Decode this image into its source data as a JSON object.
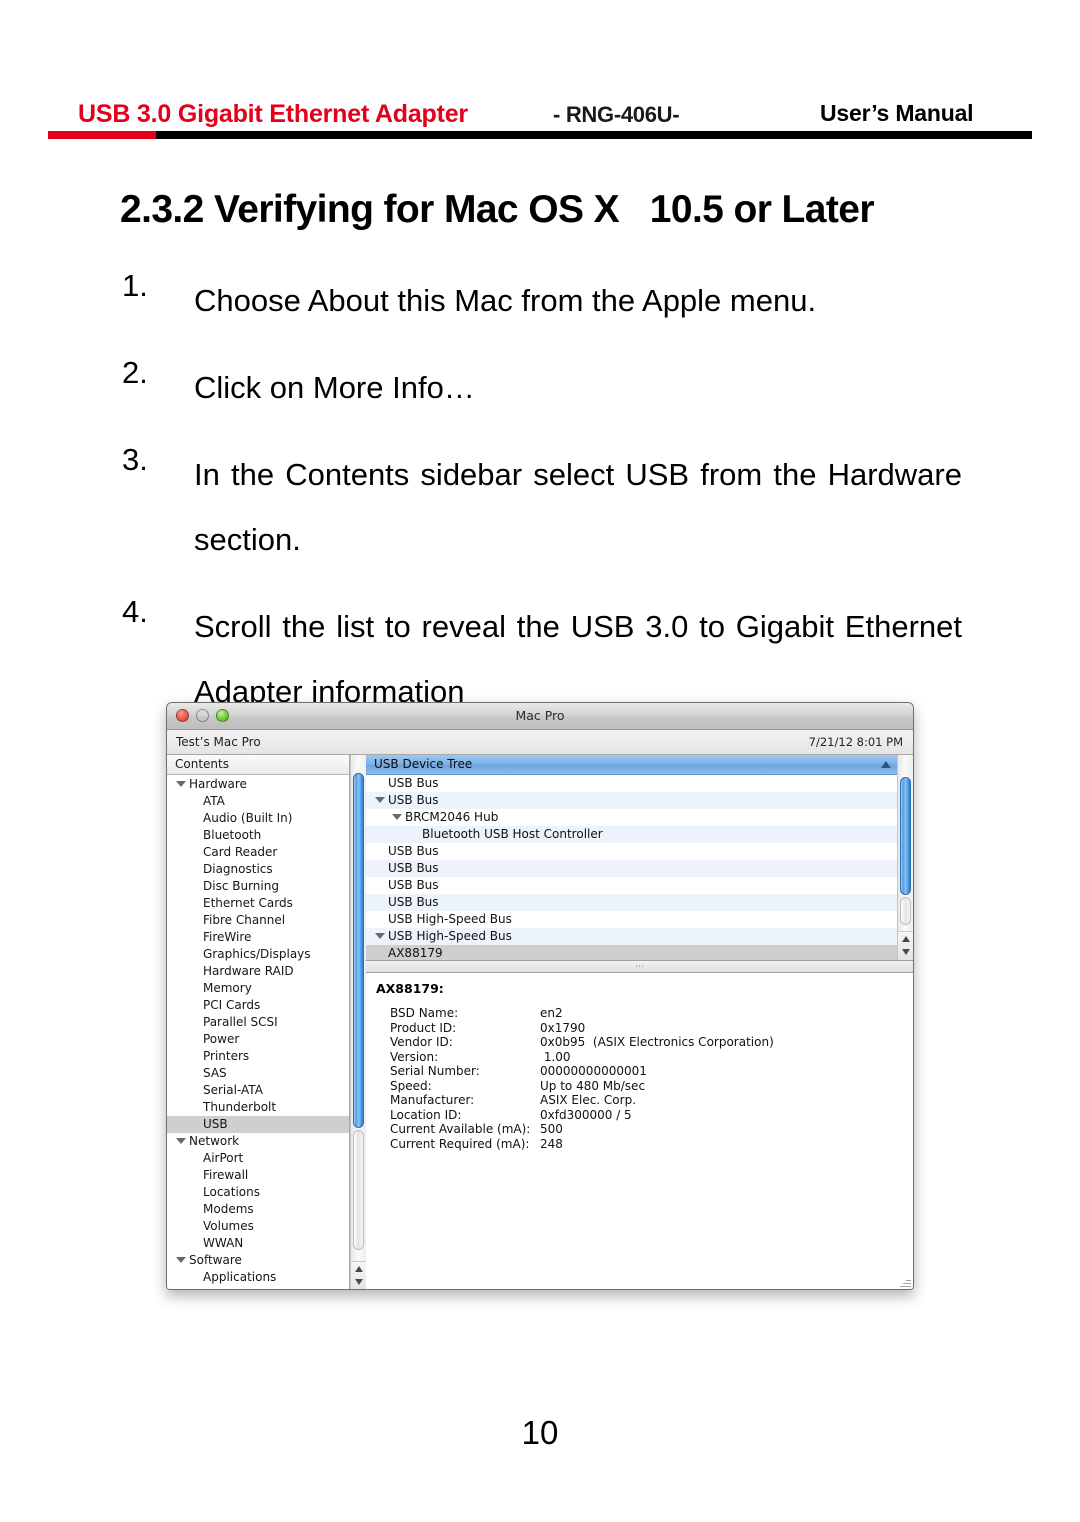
{
  "header": {
    "product_title": "USB 3.0 Gigabit Ethernet Adapter",
    "model": "- RNG-406U-",
    "doc_type": "User’s Manual",
    "accent_color": "#e2001a",
    "rule_color": "#000000"
  },
  "section": {
    "title": "2.3.2 Verifying for Mac OS X   10.5 or Later"
  },
  "steps": [
    {
      "num": "1.",
      "text": "Choose About this Mac from the Apple menu."
    },
    {
      "num": "2.",
      "text": "Click on More Info…"
    },
    {
      "num": "3.",
      "text": "In the Contents sidebar select USB from the Hardware section."
    },
    {
      "num": "4.",
      "text": "Scroll the list to reveal the USB 3.0 to Gigabit Ethernet Adapter information"
    }
  ],
  "screenshot": {
    "window_title": "Mac Pro",
    "machine_name": "Test’s Mac Pro",
    "timestamp": "7/21/12 8:01 PM",
    "traffic_lights": [
      "close-button",
      "minimize-button",
      "zoom-button"
    ],
    "sidebar": {
      "header": "Contents",
      "items": [
        {
          "label": "Hardware",
          "level": 0,
          "disclosure": true,
          "selected": false
        },
        {
          "label": "ATA",
          "level": 1,
          "disclosure": false,
          "selected": false
        },
        {
          "label": "Audio (Built In)",
          "level": 1,
          "disclosure": false,
          "selected": false
        },
        {
          "label": "Bluetooth",
          "level": 1,
          "disclosure": false,
          "selected": false
        },
        {
          "label": "Card Reader",
          "level": 1,
          "disclosure": false,
          "selected": false
        },
        {
          "label": "Diagnostics",
          "level": 1,
          "disclosure": false,
          "selected": false
        },
        {
          "label": "Disc Burning",
          "level": 1,
          "disclosure": false,
          "selected": false
        },
        {
          "label": "Ethernet Cards",
          "level": 1,
          "disclosure": false,
          "selected": false
        },
        {
          "label": "Fibre Channel",
          "level": 1,
          "disclosure": false,
          "selected": false
        },
        {
          "label": "FireWire",
          "level": 1,
          "disclosure": false,
          "selected": false
        },
        {
          "label": "Graphics/Displays",
          "level": 1,
          "disclosure": false,
          "selected": false
        },
        {
          "label": "Hardware RAID",
          "level": 1,
          "disclosure": false,
          "selected": false
        },
        {
          "label": "Memory",
          "level": 1,
          "disclosure": false,
          "selected": false
        },
        {
          "label": "PCI Cards",
          "level": 1,
          "disclosure": false,
          "selected": false
        },
        {
          "label": "Parallel SCSI",
          "level": 1,
          "disclosure": false,
          "selected": false
        },
        {
          "label": "Power",
          "level": 1,
          "disclosure": false,
          "selected": false
        },
        {
          "label": "Printers",
          "level": 1,
          "disclosure": false,
          "selected": false
        },
        {
          "label": "SAS",
          "level": 1,
          "disclosure": false,
          "selected": false
        },
        {
          "label": "Serial-ATA",
          "level": 1,
          "disclosure": false,
          "selected": false
        },
        {
          "label": "Thunderbolt",
          "level": 1,
          "disclosure": false,
          "selected": false
        },
        {
          "label": "USB",
          "level": 1,
          "disclosure": false,
          "selected": true
        },
        {
          "label": "Network",
          "level": 0,
          "disclosure": true,
          "selected": false
        },
        {
          "label": "AirPort",
          "level": 1,
          "disclosure": false,
          "selected": false
        },
        {
          "label": "Firewall",
          "level": 1,
          "disclosure": false,
          "selected": false
        },
        {
          "label": "Locations",
          "level": 1,
          "disclosure": false,
          "selected": false
        },
        {
          "label": "Modems",
          "level": 1,
          "disclosure": false,
          "selected": false
        },
        {
          "label": "Volumes",
          "level": 1,
          "disclosure": false,
          "selected": false
        },
        {
          "label": "WWAN",
          "level": 1,
          "disclosure": false,
          "selected": false
        },
        {
          "label": "Software",
          "level": 0,
          "disclosure": true,
          "selected": false
        },
        {
          "label": "Applications",
          "level": 1,
          "disclosure": false,
          "selected": false
        }
      ]
    },
    "device_tree": {
      "column_header": "USB Device Tree",
      "rows": [
        {
          "label": "USB Bus",
          "level": 0,
          "disclosure": false,
          "selected": false
        },
        {
          "label": "USB Bus",
          "level": 0,
          "disclosure": true,
          "selected": false
        },
        {
          "label": "BRCM2046 Hub",
          "level": 1,
          "disclosure": true,
          "selected": false
        },
        {
          "label": "Bluetooth USB Host Controller",
          "level": 2,
          "disclosure": false,
          "selected": false
        },
        {
          "label": "USB Bus",
          "level": 0,
          "disclosure": false,
          "selected": false
        },
        {
          "label": "USB Bus",
          "level": 0,
          "disclosure": false,
          "selected": false
        },
        {
          "label": "USB Bus",
          "level": 0,
          "disclosure": false,
          "selected": false
        },
        {
          "label": "USB Bus",
          "level": 0,
          "disclosure": false,
          "selected": false
        },
        {
          "label": "USB High-Speed Bus",
          "level": 0,
          "disclosure": false,
          "selected": false
        },
        {
          "label": "USB High-Speed Bus",
          "level": 0,
          "disclosure": true,
          "selected": false
        },
        {
          "label": "AX88179",
          "level": 0,
          "disclosure": false,
          "selected": true
        }
      ]
    },
    "detail": {
      "title": "AX88179:",
      "rows": [
        {
          "key": "BSD Name:",
          "value": "en2"
        },
        {
          "key": "Product ID:",
          "value": "0x1790"
        },
        {
          "key": "Vendor ID:",
          "value": "0x0b95  (ASIX Electronics Corporation)"
        },
        {
          "key": "Version:",
          "value": " 1.00"
        },
        {
          "key": "Serial Number:",
          "value": "00000000000001"
        },
        {
          "key": "Speed:",
          "value": "Up to 480 Mb/sec"
        },
        {
          "key": "Manufacturer:",
          "value": "ASIX Elec. Corp."
        },
        {
          "key": "Location ID:",
          "value": "0xfd300000 / 5"
        },
        {
          "key": "Current Available (mA):",
          "value": "500"
        },
        {
          "key": "Current Required (mA):",
          "value": "248"
        }
      ]
    }
  },
  "footer": {
    "page_number": "10"
  }
}
